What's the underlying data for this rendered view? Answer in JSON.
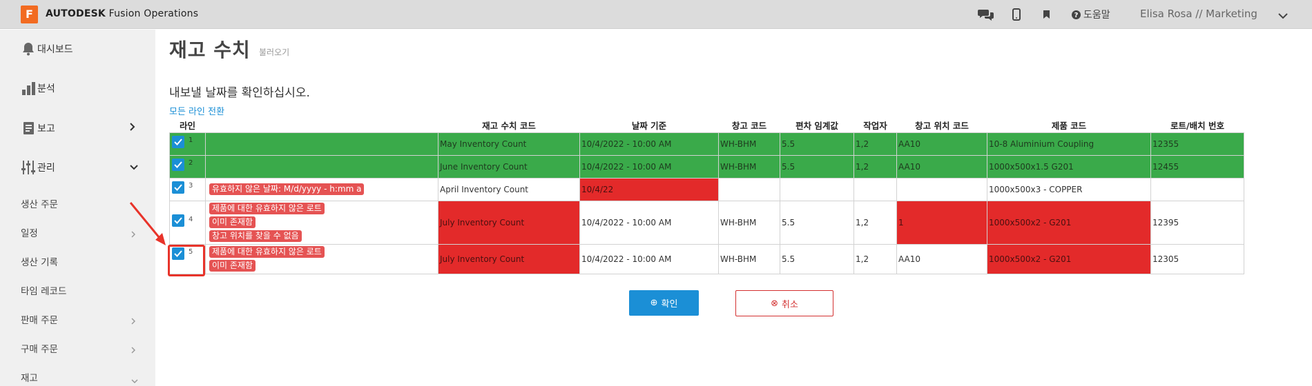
{
  "app": {
    "logo_letter": "F",
    "brand_bold": "AUTODESK",
    "brand_rest": " Fusion Operations",
    "help_label": "도움말",
    "user": "Elisa Rosa // Marketing"
  },
  "sidebar": {
    "dashboard": "대시보드",
    "analysis": "분석",
    "report": "보고",
    "manage": "관리",
    "sub": [
      "생산 주문",
      "일정",
      "생산 기록",
      "타임 레코드",
      "판매 주문",
      "구매 주문",
      "재고"
    ]
  },
  "page": {
    "title": "재고 수치",
    "subtitle": "불러오기",
    "message": "내보낼 날짜를 확인하십시오.",
    "toggle_all": "모든 라인 전환"
  },
  "table": {
    "headers": [
      "라인",
      "",
      "재고 수치 코드",
      "날짜 기준",
      "창고 코드",
      "편차 임계값",
      "작업자",
      "창고 위치 코드",
      "제품 코드",
      "로트/배치 번호"
    ],
    "rows": [
      {
        "num": "1",
        "errors": [],
        "code": "May Inventory Count",
        "date": "10/4/2022 - 10:00 AM",
        "wh": "WH-BHM",
        "dev": "5.5",
        "op": "1,2",
        "loc": "AA10",
        "product": "10-8 Aluminium Coupling",
        "lot": "12355"
      },
      {
        "num": "2",
        "errors": [],
        "code": "June Inventory Count",
        "date": "10/4/2022 - 10:00 AM",
        "wh": "WH-BHM",
        "dev": "5.5",
        "op": "1,2",
        "loc": "AA10",
        "product": "1000x500x1.5 G201",
        "lot": "12455"
      },
      {
        "num": "3",
        "errors": [
          "유효하지 않은 날짜: M/d/yyyy - h:mm a"
        ],
        "code": "April Inventory Count",
        "date": "10/4/22",
        "wh": "",
        "dev": "",
        "op": "",
        "loc": "",
        "product": "1000x500x3 - COPPER",
        "lot": ""
      },
      {
        "num": "4",
        "errors": [
          "제품에 대한 유효하지 않은 로트",
          "이미 존재함",
          "창고 위치를 찾을 수 없음"
        ],
        "code": "July Inventory Count",
        "date": "10/4/2022 - 10:00 AM",
        "wh": "WH-BHM",
        "dev": "5.5",
        "op": "1,2",
        "loc": "1",
        "product": "1000x500x2 - G201",
        "lot": "12395"
      },
      {
        "num": "5",
        "errors": [
          "제품에 대한 유효하지 않은 로트",
          "이미 존재함"
        ],
        "code": "July Inventory Count",
        "date": "10/4/2022 - 10:00 AM",
        "wh": "WH-BHM",
        "dev": "5.5",
        "op": "1,2",
        "loc": "AA10",
        "product": "1000x500x2 - G201",
        "lot": "12305"
      }
    ]
  },
  "buttons": {
    "ok_icon": "⊕",
    "ok": "확인",
    "cancel_icon": "⊗",
    "cancel": "취소"
  },
  "colors": {
    "valid_row": "#3aaa4a",
    "error_cell": "#e32a2a",
    "accent": "#1b8fd6",
    "brand": "#f26b21"
  }
}
